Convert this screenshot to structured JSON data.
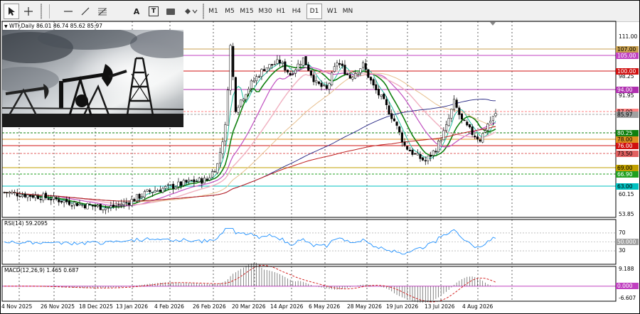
{
  "toolbar": {
    "tools": [
      "cursor-icon",
      "crosshair-icon",
      "horizontal-line-icon",
      "trendline-icon",
      "fibonacci-icon",
      "text-icon",
      "label-icon",
      "rectangle-icon",
      "shapes-icon"
    ],
    "text_tool": "A",
    "label_tool": "T",
    "timeframes": [
      "M1",
      "M5",
      "M15",
      "M30",
      "H1",
      "H4",
      "D1",
      "W1",
      "MN"
    ],
    "active_timeframe": "D1"
  },
  "chart": {
    "header": "WTI,Daily  86.01 86.74 85.62 85.97",
    "price_axis": [
      "111.00",
      "98.25",
      "91.95",
      "72.75",
      "60.15",
      "53.85"
    ],
    "levels": [
      {
        "label": "107.00",
        "color": "#c8a050"
      },
      {
        "label": "105.00",
        "color": "#c040c0"
      },
      {
        "label": "100.00",
        "color": "#d01010"
      },
      {
        "label": "94.00",
        "color": "#b030b0"
      },
      {
        "label": "87.00",
        "color": "#ff8080"
      },
      {
        "label": "85.97",
        "color": "#a0a0a0"
      },
      {
        "label": "80.25",
        "color": "#108010"
      },
      {
        "label": "78.00",
        "color": "#e09020"
      },
      {
        "label": "76.00",
        "color": "#d01010"
      },
      {
        "label": "73.50",
        "color": "#e06060"
      },
      {
        "label": "69.00",
        "color": "#c0a000"
      },
      {
        "label": "66.90",
        "color": "#20a020"
      },
      {
        "label": "63.00",
        "color": "#00c0c0"
      }
    ],
    "dates": [
      "4 Nov 2025",
      "26 Nov 2025",
      "18 Dec 2025",
      "13 Jan 2026",
      "4 Feb 2026",
      "26 Feb 2026",
      "20 Mar 2026",
      "14 Apr 2026",
      "6 May 2026",
      "28 May 2026",
      "19 Jun 2026",
      "13 Jul 2026",
      "4 Aug 2026"
    ]
  },
  "rsi": {
    "label": "RSI(14) 59.2095",
    "axis": [
      "70",
      "50.000",
      "30"
    ]
  },
  "macd": {
    "label": "MACD(12,26,9) 1.465 0.687",
    "axis": [
      "9.188",
      "0.000",
      "-6.607"
    ]
  }
}
